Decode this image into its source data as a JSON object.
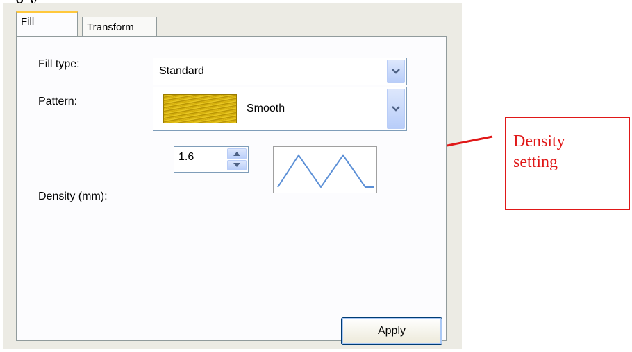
{
  "heading_partial": "g          y",
  "tabs": [
    {
      "label": "Fill",
      "selected": true
    },
    {
      "label": "Transform",
      "selected": false
    }
  ],
  "fill_type": {
    "label": "Fill type:",
    "value": "Standard"
  },
  "pattern": {
    "label": "Pattern:",
    "value": "Smooth"
  },
  "density": {
    "label": "Density (mm):",
    "value": "1.6"
  },
  "apply_label": "Apply",
  "annotation": {
    "line1": "Density",
    "line2": "setting",
    "color": "#e01818"
  },
  "colors": {
    "accent": "#ffc83c",
    "border": "#7f9db9",
    "panel": "#ecebe4"
  }
}
